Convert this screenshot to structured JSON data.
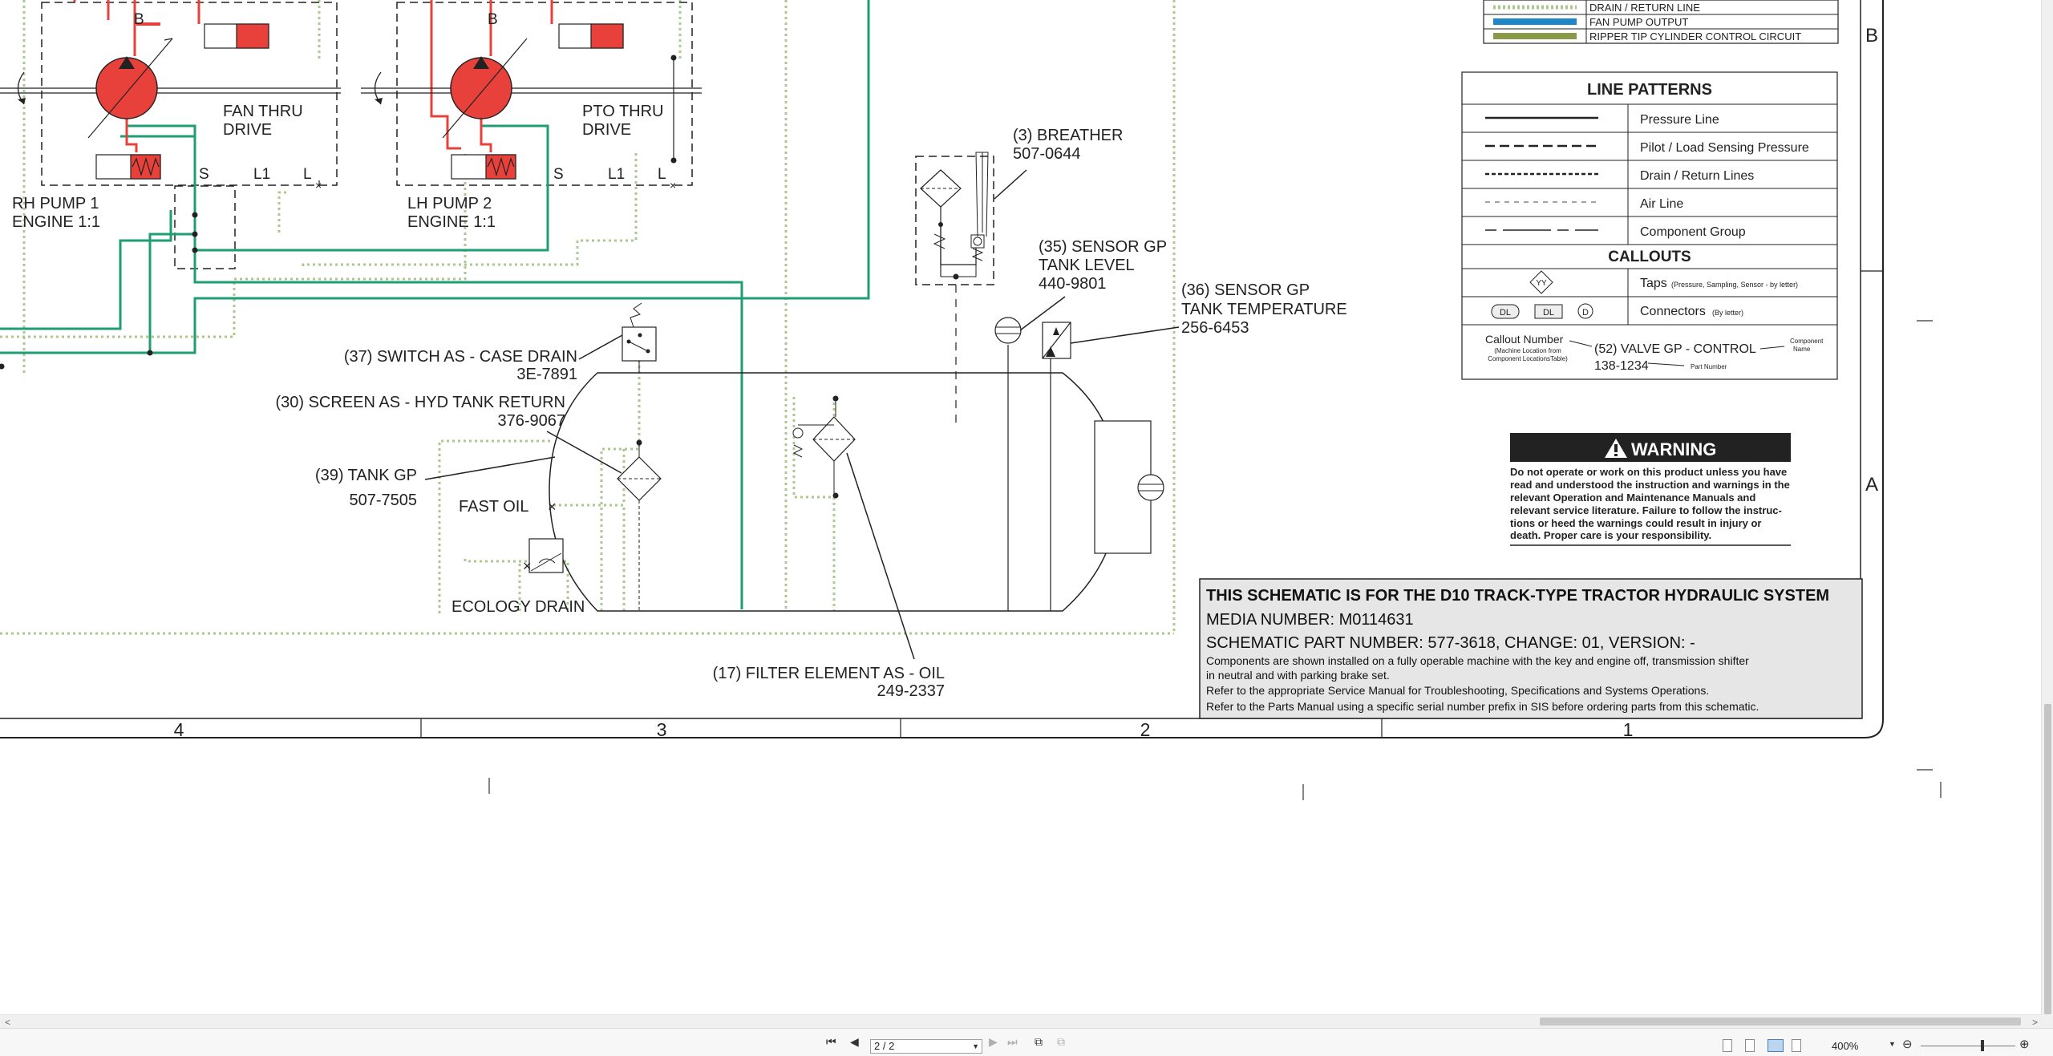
{
  "diagram": {
    "pumps": [
      {
        "port_b": "B",
        "drive": [
          "FAN THRU",
          "DRIVE"
        ],
        "name": [
          "RH PUMP 1",
          "ENGINE 1:1"
        ],
        "ports": [
          "S",
          "L1",
          "L"
        ]
      },
      {
        "port_b": "B",
        "drive": [
          "PTO THRU",
          "DRIVE"
        ],
        "name": [
          "LH PUMP 2",
          "ENGINE 1:1"
        ],
        "ports": [
          "S",
          "L1",
          "L"
        ]
      }
    ],
    "callouts": {
      "breather": {
        "name": "(3) BREATHER",
        "part": "507-0644"
      },
      "sensor_level": {
        "name": "(35) SENSOR GP",
        "desc": "TANK LEVEL",
        "part": "440-9801"
      },
      "sensor_temp": {
        "name": "(36) SENSOR GP",
        "desc": "TANK TEMPERATURE",
        "part": "256-6453"
      },
      "switch": {
        "name": "(37) SWITCH AS - CASE DRAIN",
        "part": "3E-7891"
      },
      "screen": {
        "name": "(30) SCREEN AS - HYD TANK RETURN",
        "part": "376-9067"
      },
      "tank": {
        "name": "(39) TANK GP",
        "part": "507-7505"
      },
      "fast_oil": "FAST OIL",
      "ecology_drain": "ECOLOGY DRAIN",
      "filter": {
        "name": "(17) FILTER ELEMENT AS - OIL",
        "part": "249-2337"
      }
    },
    "zones": [
      "4",
      "3",
      "2",
      "1"
    ],
    "side_letters": [
      "B",
      "A"
    ]
  },
  "legend_colors": {
    "items": [
      {
        "label": "DRAIN / RETURN LINE",
        "color": "#a9c98f",
        "style": "dotted"
      },
      {
        "label": "FAN PUMP OUTPUT",
        "color": "#1f86c8",
        "style": "solid"
      },
      {
        "label": "RIPPER TIP CYLINDER CONTROL CIRCUIT",
        "color": "#8a9a48",
        "style": "solid"
      }
    ]
  },
  "line_patterns": {
    "title": "LINE PATTERNS",
    "rows": [
      "Pressure Line",
      "Pilot / Load Sensing Pressure",
      "Drain / Return Lines",
      "Air Line",
      "Component Group"
    ],
    "callouts_title": "CALLOUTS",
    "taps_symbol": "YY",
    "taps_label": "Taps",
    "taps_note": "(Pressure, Sampling, Sensor - by letter)",
    "conn_symbols": [
      "DL",
      "DL",
      "D"
    ],
    "conn_label": "Connectors",
    "conn_note": "(By letter)",
    "callout_number": "Callout Number",
    "callout_number_note1": "(Machine Location from",
    "callout_number_note2": "Component LocationsTable)",
    "callout_example": "(52) VALVE GP - CONTROL",
    "callout_part": "138-1234",
    "component_name1": "Component",
    "component_name2": "Name",
    "part_number": "Part Number"
  },
  "warning": {
    "title": "WARNING",
    "lines": [
      "Do not operate or work on this product unless you have",
      "read and understood the instruction and warnings in the",
      "relevant Operation and Maintenance Manuals and",
      "relevant service literature. Failure to follow the instruc-",
      "tions or heed the warnings could result in injury or",
      "death. Proper care is your responsibility."
    ]
  },
  "title_block": {
    "title": "THIS SCHEMATIC IS FOR THE D10 TRACK-TYPE TRACTOR HYDRAULIC SYSTEM",
    "media": "MEDIA NUMBER: M0114631",
    "part": "SCHEMATIC PART NUMBER: 577-3618, CHANGE: 01, VERSION: -",
    "notes": [
      "Components are shown installed on a fully operable machine with the key and engine off, transmission shifter",
      "in neutral and with parking brake set.",
      "Refer to the appropriate Service Manual for Troubleshooting, Specifications and Systems Operations.",
      "Refer to the Parts Manual using a specific serial number prefix in SIS before ordering parts from this schematic."
    ]
  },
  "viewer": {
    "page_field": "2 / 2",
    "zoom": "400%"
  }
}
